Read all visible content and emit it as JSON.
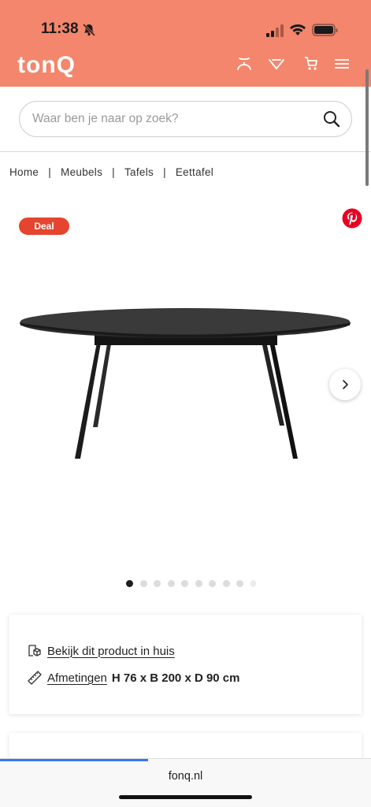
{
  "status": {
    "time": "11:38"
  },
  "header": {
    "logo": "tonQ"
  },
  "search": {
    "placeholder": "Waar ben je naar op zoek?"
  },
  "breadcrumb": [
    "Home",
    "Meubels",
    "Tafels",
    "Eettafel"
  ],
  "product": {
    "badge": "Deal",
    "carousel": {
      "total_dots": 10,
      "active_index": 0
    }
  },
  "info": {
    "view_in_home": "Bekijk dit product in huis",
    "dimensions_label": "Afmetingen",
    "dimensions_value": "H 76 x B 200 x D 90 cm"
  },
  "browser": {
    "url": "fonq.nl",
    "load_progress": 0.4
  },
  "colors": {
    "brand": "#f3866c",
    "deal": "#e5452f",
    "pinterest": "#e60023"
  },
  "icons": [
    "bell-slash-icon",
    "signal-icon",
    "wifi-icon",
    "battery-icon",
    "account-icon",
    "wishlist-icon",
    "cart-icon",
    "menu-icon",
    "search-icon",
    "pinterest-icon",
    "chevron-right-icon",
    "cube-icon",
    "ruler-icon"
  ]
}
